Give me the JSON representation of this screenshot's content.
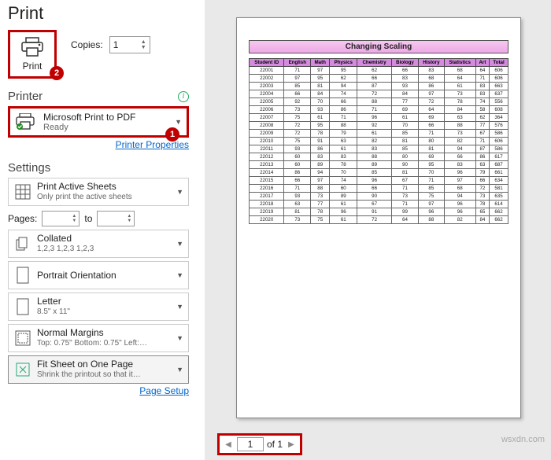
{
  "title": "Print",
  "print_button_label": "Print",
  "copies_label": "Copies:",
  "copies_value": "1",
  "badge1": "1",
  "badge2": "2",
  "printer_section": "Printer",
  "printer": {
    "name": "Microsoft Print to PDF",
    "status": "Ready",
    "properties_link": "Printer Properties"
  },
  "settings_section": "Settings",
  "settings": {
    "sheets": {
      "t1": "Print Active Sheets",
      "t2": "Only print the active sheets"
    },
    "pages_label": "Pages:",
    "pages_to": "to",
    "collate": {
      "t1": "Collated",
      "t2": "1,2,3   1,2,3   1,2,3"
    },
    "orient": {
      "t1": "Portrait Orientation",
      "t2": ""
    },
    "paper": {
      "t1": "Letter",
      "t2": "8.5\" x 11\""
    },
    "margins": {
      "t1": "Normal Margins",
      "t2": "Top: 0.75\" Bottom: 0.75\" Left:…"
    },
    "scale": {
      "t1": "Fit Sheet on One Page",
      "t2": "Shrink the printout so that it…"
    },
    "page_setup_link": "Page Setup"
  },
  "page_nav": {
    "current": "1",
    "of_label": "of 1"
  },
  "watermark": "wsxdn.com",
  "chart_data": {
    "type": "table",
    "title": "Changing Scaling",
    "headers": [
      "Student ID",
      "English",
      "Math",
      "Physics",
      "Chemistry",
      "Biology",
      "History",
      "Statistics",
      "Art",
      "Total"
    ],
    "rows": [
      [
        "22001",
        71,
        97,
        95,
        62,
        66,
        83,
        68,
        64,
        606
      ],
      [
        "22002",
        97,
        95,
        62,
        66,
        83,
        68,
        64,
        71,
        606
      ],
      [
        "22003",
        85,
        81,
        94,
        87,
        93,
        86,
        61,
        83,
        663
      ],
      [
        "22004",
        66,
        84,
        74,
        72,
        84,
        97,
        73,
        83,
        637
      ],
      [
        "22005",
        92,
        70,
        66,
        88,
        77,
        72,
        78,
        74,
        556
      ],
      [
        "22006",
        73,
        93,
        86,
        71,
        69,
        64,
        84,
        58,
        608
      ],
      [
        "22007",
        75,
        61,
        71,
        96,
        61,
        69,
        63,
        62,
        364
      ],
      [
        "22008",
        72,
        95,
        88,
        92,
        70,
        66,
        88,
        77,
        576
      ],
      [
        "22009",
        72,
        78,
        79,
        61,
        85,
        71,
        73,
        67,
        586
      ],
      [
        "22010",
        75,
        91,
        63,
        82,
        81,
        80,
        82,
        71,
        606
      ],
      [
        "22011",
        93,
        86,
        61,
        83,
        85,
        81,
        94,
        87,
        586
      ],
      [
        "22012",
        60,
        83,
        83,
        88,
        80,
        69,
        66,
        86,
        617
      ],
      [
        "22013",
        60,
        89,
        78,
        89,
        90,
        95,
        83,
        63,
        687
      ],
      [
        "22014",
        86,
        94,
        70,
        85,
        81,
        70,
        96,
        79,
        661
      ],
      [
        "22015",
        66,
        97,
        74,
        96,
        67,
        71,
        97,
        66,
        634
      ],
      [
        "22016",
        71,
        88,
        60,
        66,
        71,
        85,
        68,
        72,
        581
      ],
      [
        "22017",
        93,
        73,
        89,
        90,
        73,
        75,
        94,
        73,
        635
      ],
      [
        "22018",
        63,
        77,
        61,
        67,
        71,
        97,
        96,
        78,
        614
      ],
      [
        "22019",
        81,
        78,
        96,
        91,
        99,
        96,
        96,
        65,
        662
      ],
      [
        "22020",
        73,
        75,
        61,
        72,
        64,
        88,
        82,
        84,
        662
      ]
    ]
  }
}
